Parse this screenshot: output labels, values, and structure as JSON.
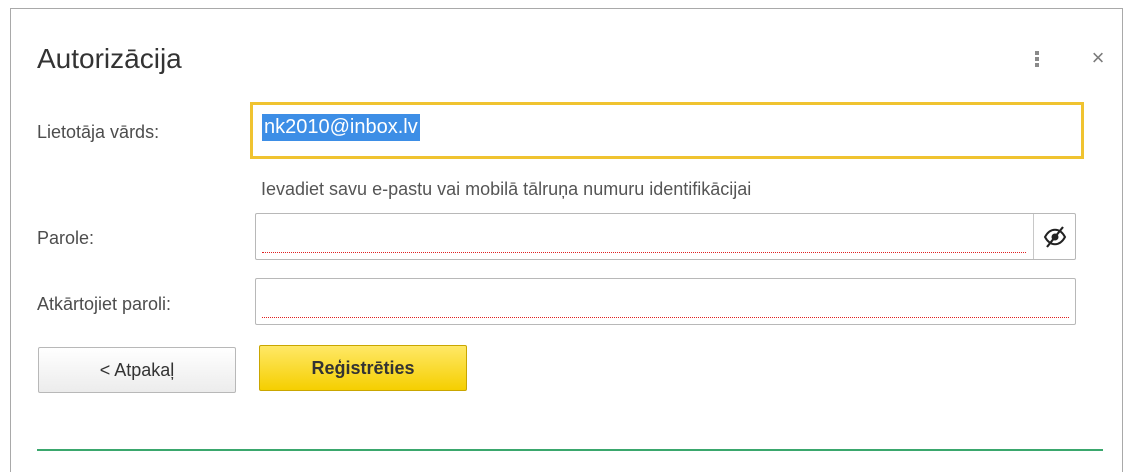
{
  "dialog": {
    "title": "Autorizācija"
  },
  "form": {
    "username_label": "Lietotāja vārds:",
    "username_value": "nk2010@inbox.lv",
    "username_hint": "Ievadiet savu e-pastu vai mobilā tālruņa numuru identifikācijai",
    "password_label": "Parole:",
    "password_value": "",
    "repeat_password_label": "Atkārtojiet paroli:",
    "repeat_password_value": ""
  },
  "buttons": {
    "back_label": "< Atpakaļ",
    "register_label": "Reģistrēties"
  },
  "icons": {
    "more": "more-vertical-icon",
    "close": "close-icon",
    "password_visibility": "eye-slash-icon"
  },
  "colors": {
    "focus_border": "#f0c330",
    "selection": "#3d8ee6",
    "primary_button": "#f5cf00",
    "required_marker": "#e02020",
    "divider": "#3aa76d"
  }
}
